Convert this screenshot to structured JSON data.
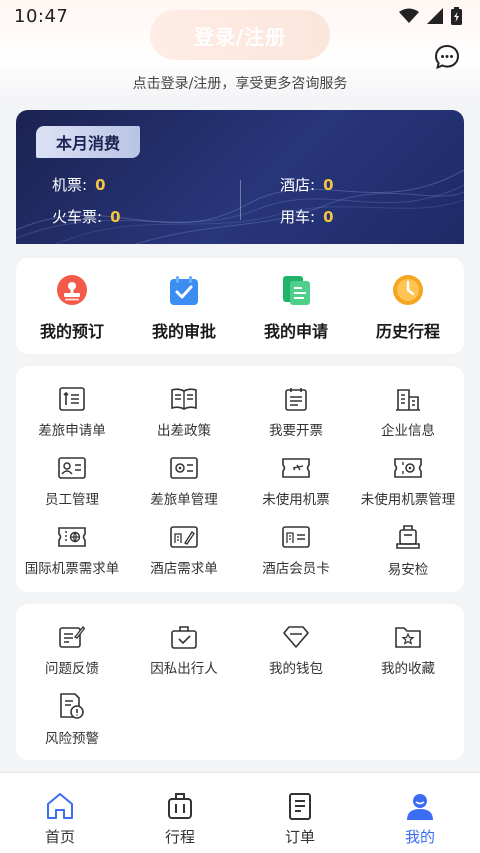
{
  "status": {
    "time": "10:47"
  },
  "header": {
    "login_label": "登录/注册",
    "login_hint": "点击登录/注册，享受更多咨询服务"
  },
  "spend": {
    "title": "本月消费",
    "flight_label": "机票:",
    "flight_value": "0",
    "hotel_label": "酒店:",
    "hotel_value": "0",
    "train_label": "火车票:",
    "train_value": "0",
    "car_label": "用车:",
    "car_value": "0"
  },
  "quick": [
    {
      "label": "我的预订",
      "icon": "stamp-icon"
    },
    {
      "label": "我的审批",
      "icon": "approval-bag-icon"
    },
    {
      "label": "我的申请",
      "icon": "application-doc-icon"
    },
    {
      "label": "历史行程",
      "icon": "clock-icon"
    }
  ],
  "services": [
    {
      "label": "差旅申请单",
      "icon": "sort-list-icon"
    },
    {
      "label": "出差政策",
      "icon": "book-icon"
    },
    {
      "label": "我要开票",
      "icon": "invoice-icon"
    },
    {
      "label": "企业信息",
      "icon": "building-icon"
    },
    {
      "label": "员工管理",
      "icon": "id-card-icon"
    },
    {
      "label": "差旅单管理",
      "icon": "gear-card-icon"
    },
    {
      "label": "未使用机票",
      "icon": "plane-ticket-icon"
    },
    {
      "label": "未使用机票管理",
      "icon": "gear-ticket-icon"
    },
    {
      "label": "国际机票需求单",
      "icon": "globe-ticket-icon"
    },
    {
      "label": "酒店需求单",
      "icon": "hotel-pen-icon"
    },
    {
      "label": "酒店会员卡",
      "icon": "hotel-card-icon"
    },
    {
      "label": "易安检",
      "icon": "luggage-icon"
    }
  ],
  "others": [
    {
      "label": "问题反馈",
      "icon": "feedback-icon"
    },
    {
      "label": "因私出行人",
      "icon": "briefcase-check-icon"
    },
    {
      "label": "我的钱包",
      "icon": "diamond-icon"
    },
    {
      "label": "我的收藏",
      "icon": "star-folder-icon"
    },
    {
      "label": "风险预警",
      "icon": "warning-doc-icon"
    }
  ],
  "tabs": [
    {
      "label": "首页",
      "icon": "home-icon"
    },
    {
      "label": "行程",
      "icon": "suitcase-icon"
    },
    {
      "label": "订单",
      "icon": "order-icon"
    },
    {
      "label": "我的",
      "icon": "user-icon"
    }
  ],
  "colors": {
    "accent": "#3a6cf4",
    "card_navy": "#1e2a66",
    "value_gold": "#f6c343"
  }
}
